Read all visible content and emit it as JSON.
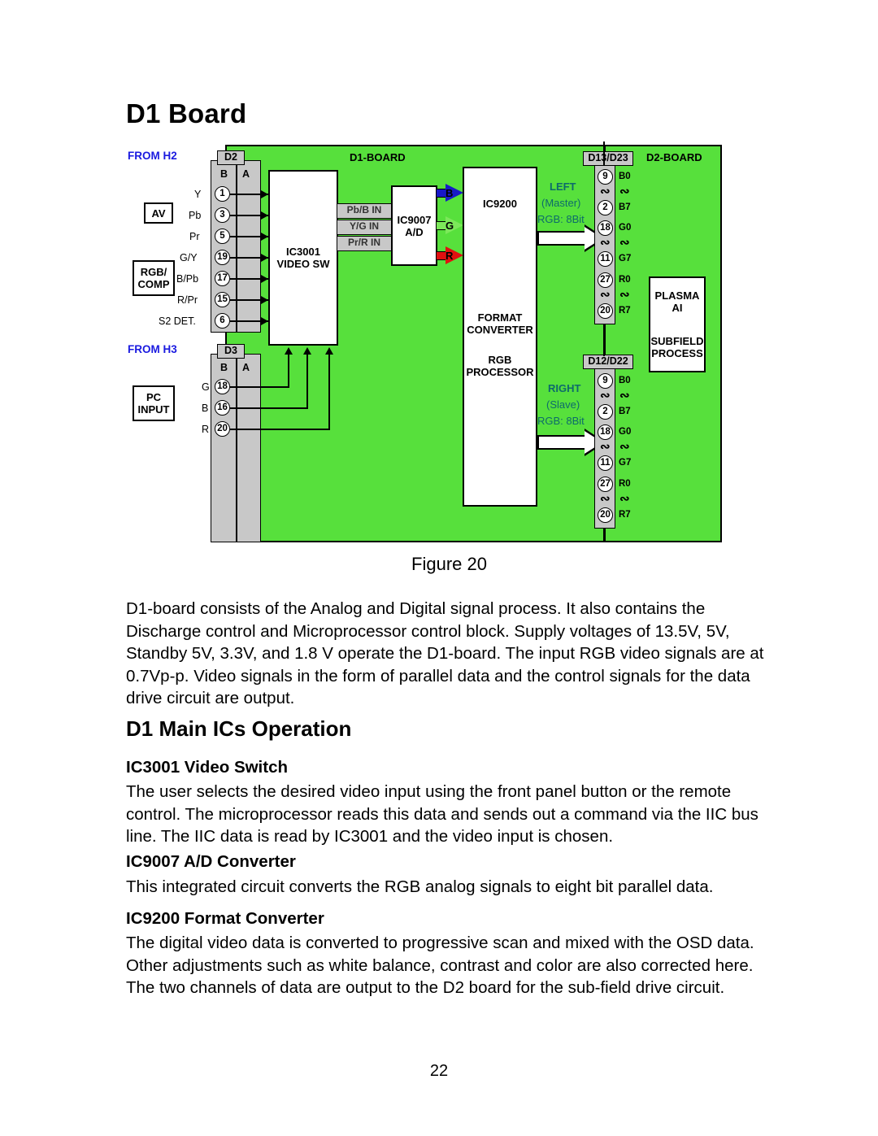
{
  "document": {
    "title": "D1 Board",
    "page_number": "22",
    "figure_caption": "Figure 20",
    "intro_paragraph": "D1-board consists of the Analog and Digital signal process. It also contains the Discharge control and Microprocessor control block. Supply voltages of 13.5V, 5V, Standby 5V, 3.3V, and 1.8 V operate the D1-board. The input RGB video signals are at 0.7Vp-p. Video signals in the form of parallel data and the control signals for the data drive circuit are output.",
    "section_heading": "D1 Main ICs Operation",
    "subsections": [
      {
        "heading": "IC3001 Video Switch",
        "body": "The user selects the desired video input using the front panel button or the remote control. The microprocessor reads this data and sends out a command via the IIC bus line. The IIC data is read by IC3001 and the video input is chosen."
      },
      {
        "heading": "IC9007 A/D Converter",
        "body": "This integrated circuit converts the RGB analog signals to eight bit parallel data."
      },
      {
        "heading": "IC9200 Format Converter",
        "body": "The digital video data is converted to progressive scan and mixed with the OSD data. Other adjustments such as white balance, contrast and color are also corrected here. The two channels of data are output to the D2 board for the sub-field drive circuit."
      }
    ]
  },
  "diagram": {
    "board_labels": {
      "d1_board": "D1-BOARD",
      "d2_board": "D2-BOARD"
    },
    "source_labels": {
      "from_h2": "FROM H2",
      "from_h3": "FROM H3"
    },
    "input_groups": [
      {
        "name": "AV",
        "label": "AV"
      },
      {
        "name": "RGB/COMP",
        "line1": "RGB/",
        "line2": "COMP"
      },
      {
        "name": "PC INPUT",
        "line1": "PC",
        "line2": "INPUT"
      }
    ],
    "connector_d2": {
      "tag": "D2",
      "col_b": "B",
      "col_a": "A",
      "pins": [
        {
          "signal": "Y",
          "number": "1"
        },
        {
          "signal": "Pb",
          "number": "3"
        },
        {
          "signal": "Pr",
          "number": "5"
        },
        {
          "signal": "G/Y",
          "number": "19"
        },
        {
          "signal": "B/Pb",
          "number": "17"
        },
        {
          "signal": "R/Pr",
          "number": "15"
        },
        {
          "signal": "S2 DET.",
          "number": "6"
        }
      ]
    },
    "connector_d3": {
      "tag": "D3",
      "col_b": "B",
      "col_a": "A",
      "pins": [
        {
          "signal": "G",
          "number": "18"
        },
        {
          "signal": "B",
          "number": "16"
        },
        {
          "signal": "R",
          "number": "20"
        }
      ]
    },
    "blocks": {
      "ic3001": {
        "line1": "IC3001",
        "line2": "VIDEO SW"
      },
      "ic9007": {
        "line1": "IC9007",
        "line2": "A/D"
      },
      "ic9200": {
        "line1": "IC9200",
        "line2": "FORMAT",
        "line3": "CONVERTER",
        "line4": "RGB",
        "line5": "PROCESSOR"
      },
      "plasma": {
        "line1": "PLASMA",
        "line2": "AI",
        "line3": "SUBFIELD",
        "line4": "PROCESS"
      }
    },
    "signal_bars": [
      {
        "label": "Pb/B IN"
      },
      {
        "label": "Y/G IN"
      },
      {
        "label": "Pr/R IN"
      }
    ],
    "color_arrows": [
      {
        "label": "B",
        "color": "#1818c8"
      },
      {
        "label": "G",
        "color": "#7ce85a"
      },
      {
        "label": "R",
        "color": "#e01010"
      }
    ],
    "output_channels": [
      {
        "name": "left",
        "line1": "LEFT",
        "line2": "(Master)",
        "line3": "RGB: 8Bit",
        "connector_tag": "D13/D23",
        "pins": [
          {
            "number": "9",
            "signal": "B0"
          },
          {
            "number": "2",
            "signal": "B7"
          },
          {
            "number": "18",
            "signal": "G0"
          },
          {
            "number": "11",
            "signal": "G7"
          },
          {
            "number": "27",
            "signal": "R0"
          },
          {
            "number": "20",
            "signal": "R7"
          }
        ]
      },
      {
        "name": "right",
        "line1": "RIGHT",
        "line2": "(Slave)",
        "line3": "RGB: 8Bit",
        "connector_tag": "D12/D22",
        "pins": [
          {
            "number": "9",
            "signal": "B0"
          },
          {
            "number": "2",
            "signal": "B7"
          },
          {
            "number": "18",
            "signal": "G0"
          },
          {
            "number": "11",
            "signal": "G7"
          },
          {
            "number": "27",
            "signal": "R0"
          },
          {
            "number": "20",
            "signal": "R7"
          }
        ]
      }
    ],
    "colors": {
      "board_green": "#57e03c",
      "connector_gray": "#c8c8c8",
      "source_blue": "#1a1ae0",
      "channel_teal": "#0d6b6b"
    }
  }
}
